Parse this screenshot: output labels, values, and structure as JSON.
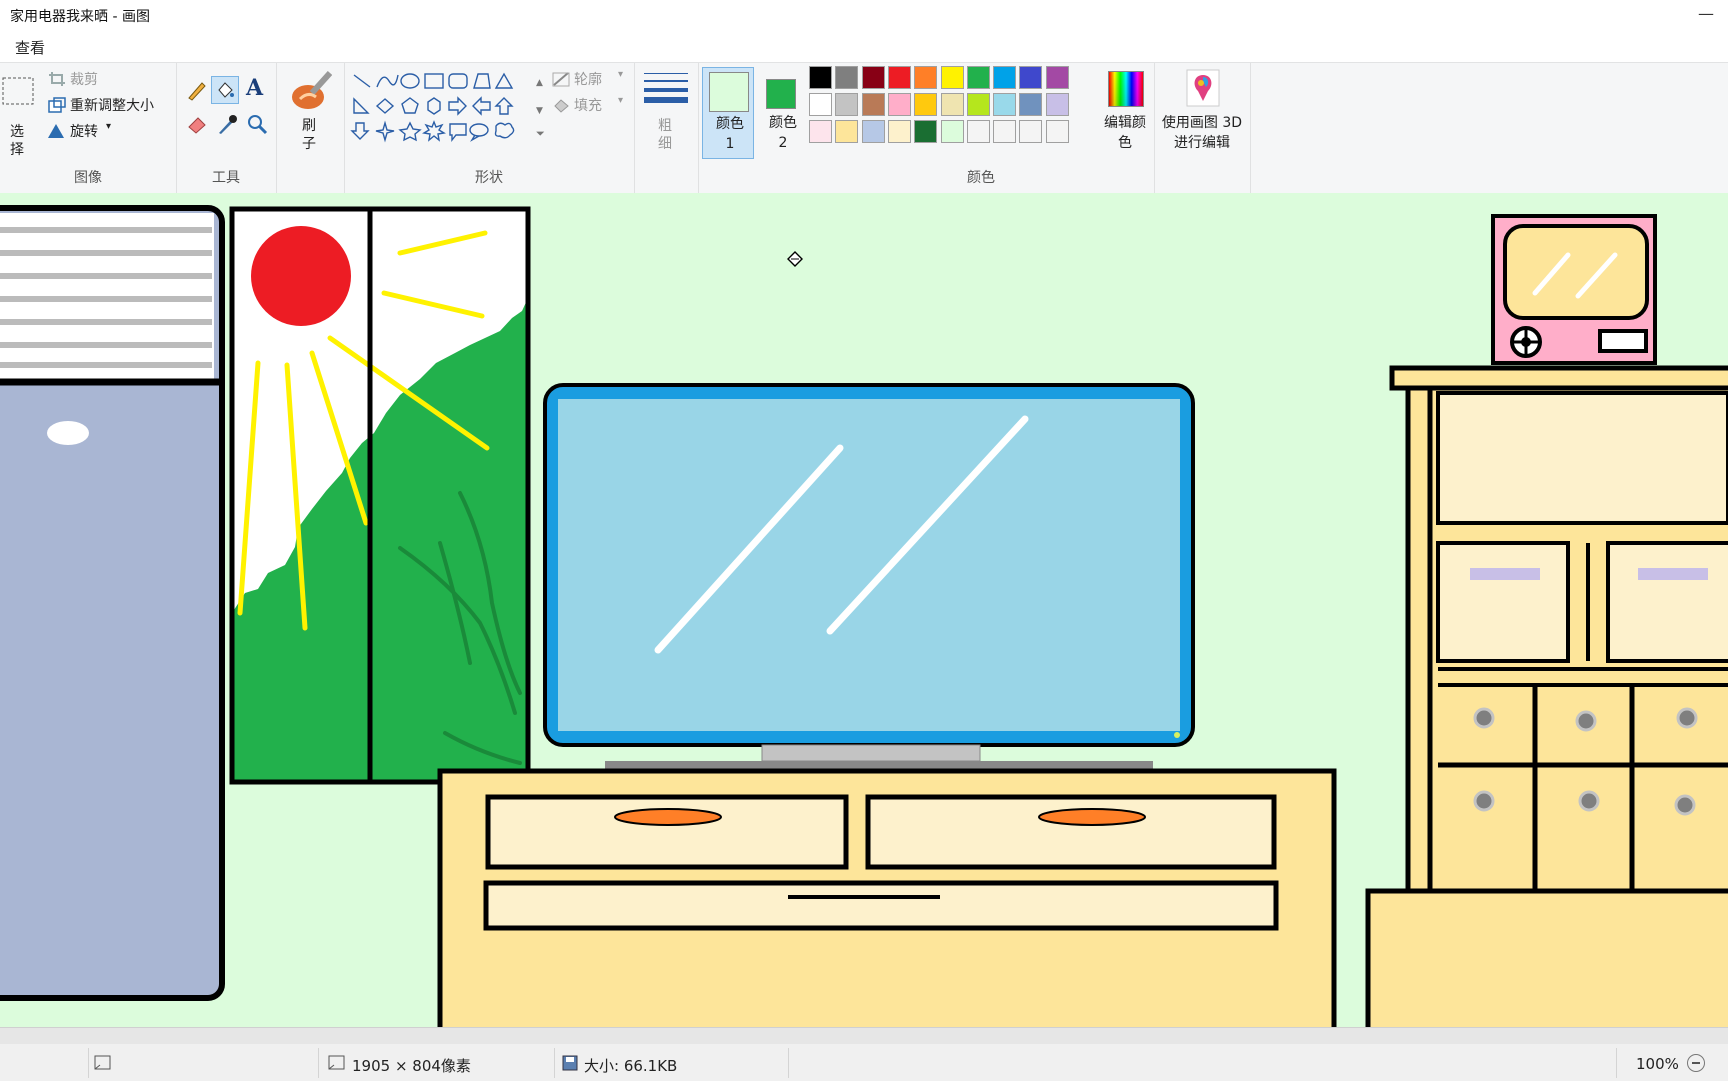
{
  "window": {
    "title": "家用电器我来晒 - 画图",
    "minimize_symbol": "—"
  },
  "menu": {
    "view": "查看"
  },
  "ribbon": {
    "image_group": {
      "label": "图像",
      "select": "选择",
      "crop": "裁剪",
      "resize": "重新调整大小",
      "rotate": "旋转"
    },
    "tools_group": {
      "label": "工具"
    },
    "brushes": {
      "label": "刷子"
    },
    "shapes_group": {
      "label": "形状",
      "outline": "轮廓",
      "fill": "填充"
    },
    "size": {
      "label": "粗细"
    },
    "color1": {
      "label": "颜色 1",
      "value": "#dcfcdc"
    },
    "color2": {
      "label": "颜色 2",
      "value": "#22b14c"
    },
    "colors_group": {
      "label": "颜色"
    },
    "edit_colors": {
      "label": "编辑颜色"
    },
    "paint3d": {
      "label": "使用画图 3D 进行编辑"
    },
    "palette": [
      "#000000",
      "#7f7f7f",
      "#880015",
      "#ed1c24",
      "#ff7f27",
      "#fff200",
      "#22b14c",
      "#00a2e8",
      "#3f48cc",
      "#a349a4",
      "#ffffff",
      "#c3c3c3",
      "#b97a57",
      "#ffaec9",
      "#ffc90e",
      "#efe4b0",
      "#b5e61d",
      "#99d9ea",
      "#7092be",
      "#c8bfe7",
      "#fde4ec",
      "#fde59a",
      "#b6c8e6",
      "#fdf1cc",
      "#1a6e32",
      "#dcfcdc",
      "#f4f4f4",
      "#f4f4f4",
      "#f4f4f4",
      "#f4f4f4"
    ]
  },
  "status": {
    "dimensions": "1905 × 804像素",
    "size": "大小: 66.1KB",
    "zoom": "100%"
  },
  "colors": {
    "canvas_bg": "#dcfcdc",
    "tv_frame": "#1a9de0",
    "tv_screen": "#99d5e7",
    "furniture": "#fde59a",
    "drawer": "#fdf1cc"
  }
}
